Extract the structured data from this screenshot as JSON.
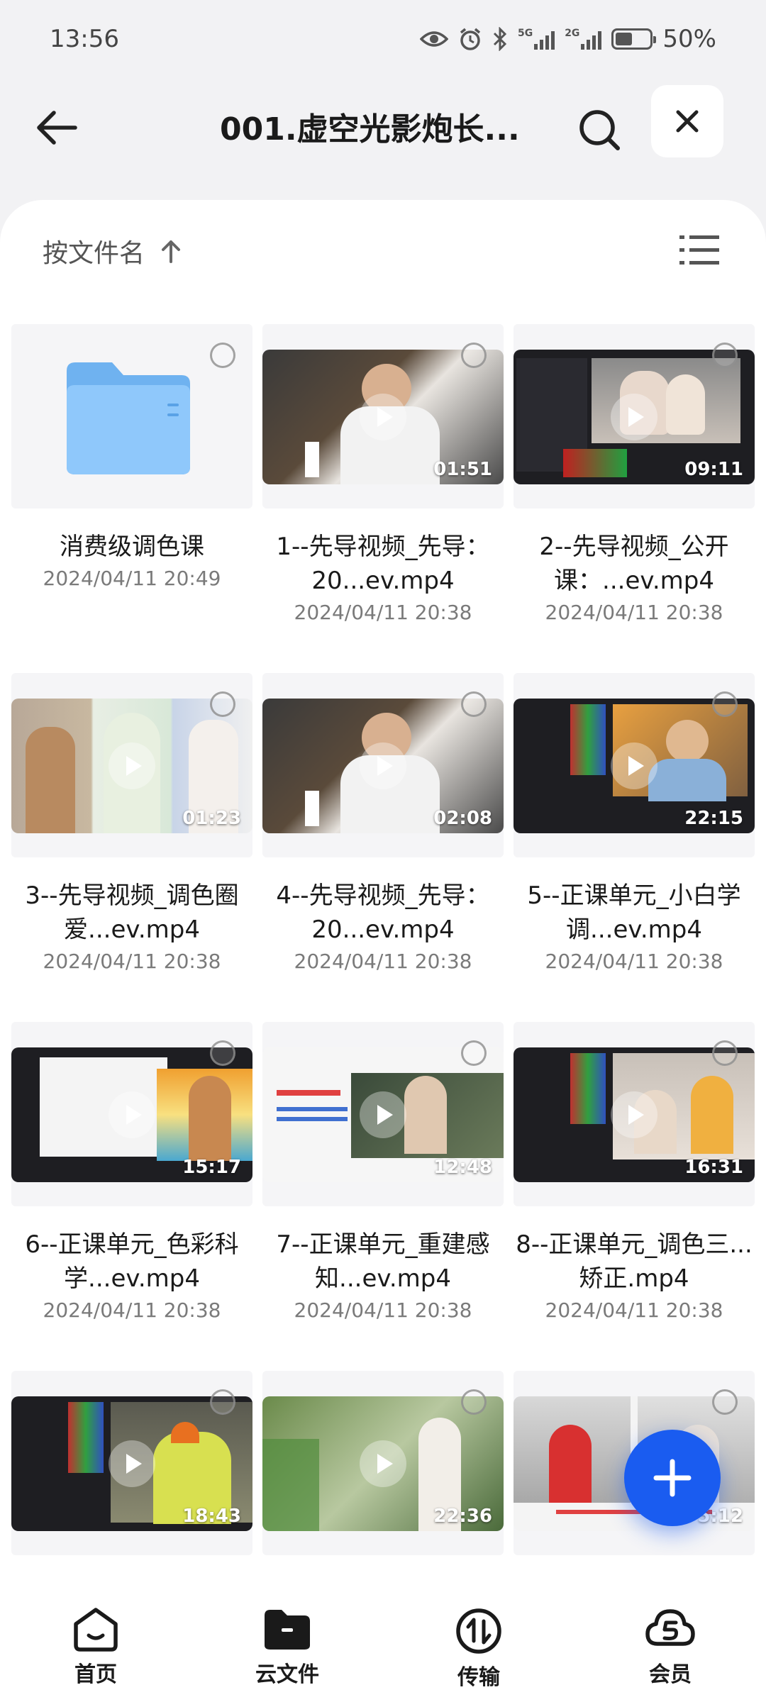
{
  "status_bar": {
    "time": "13:56",
    "battery_text": "50%",
    "battery_level": 0.5,
    "signal_tag_1": "5G",
    "signal_tag_2": "2G",
    "icons": [
      "eye-icon",
      "alarm-icon",
      "bluetooth-icon",
      "signal-5g-icon",
      "signal-2g-icon",
      "battery-icon"
    ]
  },
  "header": {
    "title": "001.虚空光影炮长...",
    "back_icon": "back-arrow-icon",
    "search_icon": "search-icon",
    "close_icon": "close-icon"
  },
  "sort": {
    "label": "按文件名",
    "direction_icon": "arrow-up-icon",
    "view_icon": "list-view-icon"
  },
  "files": [
    {
      "kind": "folder",
      "name": "消费级调色课",
      "date": "2024/04/11 20:49"
    },
    {
      "kind": "video",
      "name": "1--先导视频_先导：20...ev.mp4",
      "date": "2024/04/11 20:38",
      "duration": "01:51"
    },
    {
      "kind": "video",
      "name": "2--先导视频_公开课：...ev.mp4",
      "date": "2024/04/11 20:38",
      "duration": "09:11"
    },
    {
      "kind": "video",
      "name": "3--先导视频_调色圈爱...ev.mp4",
      "date": "2024/04/11 20:38",
      "duration": "01:23"
    },
    {
      "kind": "video",
      "name": "4--先导视频_先导：20...ev.mp4",
      "date": "2024/04/11 20:38",
      "duration": "02:08"
    },
    {
      "kind": "video",
      "name": "5--正课单元_小白学调...ev.mp4",
      "date": "2024/04/11 20:38",
      "duration": "22:15"
    },
    {
      "kind": "video",
      "name": "6--正课单元_色彩科学...ev.mp4",
      "date": "2024/04/11 20:38",
      "duration": "15:17"
    },
    {
      "kind": "video",
      "name": "7--正课单元_重建感知...ev.mp4",
      "date": "2024/04/11 20:38",
      "duration": "12:48"
    },
    {
      "kind": "video",
      "name": "8--正课单元_调色三...矫正.mp4",
      "date": "2024/04/11 20:38",
      "duration": "16:31"
    },
    {
      "kind": "video",
      "name": "",
      "date": "",
      "duration": "18:43"
    },
    {
      "kind": "video",
      "name": "",
      "date": "",
      "duration": "22:36"
    },
    {
      "kind": "video",
      "name": "",
      "date": "",
      "duration": "5:12"
    }
  ],
  "fab": {
    "icon": "plus-icon"
  },
  "bottom_nav": [
    {
      "label": "首页",
      "icon": "home-icon"
    },
    {
      "label": "云文件",
      "icon": "folder-icon"
    },
    {
      "label": "传输",
      "icon": "transfer-icon"
    },
    {
      "label": "会员",
      "icon": "vip-icon"
    }
  ]
}
